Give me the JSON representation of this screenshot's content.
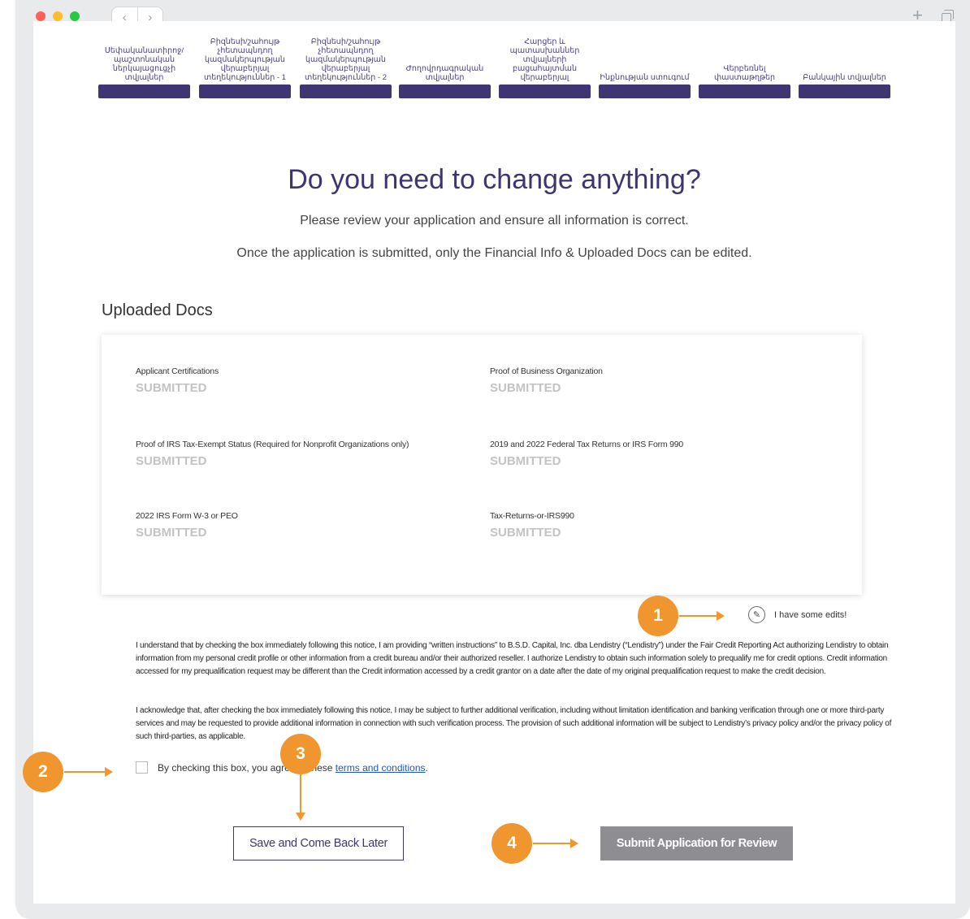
{
  "steps": [
    "Սեփականատիրոջ/պաշտոնական ներկայացուցչի տվյալներ",
    "Բիզնեսի/շահույթ չհետապնդող կազմակերպության վերաբերյալ տեղեկություններ - 1",
    "Բիզնեսի/շահույթ չհետապնդող կազմակերպության վերաբերյալ տեղեկություններ - 2",
    "Ժողովրդագրական տվյալներ",
    "Հարցեր և պատասխաններ տվյալների բացահայտման վերաբերյալ",
    "Ինքնության ստուգում",
    "Վերբեռնել փաստաթղթեր",
    "Բանկային տվյալներ"
  ],
  "review": {
    "heading": "Do you need to change anything?",
    "line1": "Please review your application and ensure all information is correct.",
    "line2": "Once the application is submitted, only the Financial Info & Uploaded Docs can be edited."
  },
  "uploaded": {
    "title": "Uploaded Docs",
    "docs": [
      {
        "name": "Applicant Certifications",
        "status": "SUBMITTED"
      },
      {
        "name": "Proof of Business Organization",
        "status": "SUBMITTED"
      },
      {
        "name": "Proof of IRS Tax-Exempt Status (Required for Nonprofit Organizations only)",
        "status": "SUBMITTED"
      },
      {
        "name": "2019 and 2022 Federal Tax Returns or IRS Form 990",
        "status": "SUBMITTED"
      },
      {
        "name": "2022 IRS Form W-3 or PEO",
        "status": "SUBMITTED"
      },
      {
        "name": "Tax-Returns-or-IRS990",
        "status": "SUBMITTED"
      }
    ]
  },
  "edits_label": "I have some edits!",
  "legal": {
    "p1": "I understand that by checking the box immediately following this notice, I am providing “written instructions” to B.S.D. Capital, Inc. dba Lendistry (“Lendistry”) under the Fair Credit Reporting Act authorizing Lendistry to obtain information from my personal credit profile or other information from a credit bureau and/or their authorized reseller. I authorize Lendistry to obtain such information solely to prequalify me for credit options. Credit information accessed for my prequalification request may be different than the Credit information accessed by a credit grantor on a date after the date of my original prequalification request to make the credit decision.",
    "p2": "I acknowledge that, after checking the box immediately following this notice, I may be subject to further additional verification, including without limitation identification and banking verification through one or more third-party services and may be requested to provide additional information in connection with such verification process. The provision of such additional information will be subject to Lendistry’s privacy policy and/or the privacy policy of such third-parties, as applicable."
  },
  "agree": {
    "text": "By checking this box, you agree to these ",
    "link": "terms and conditions",
    "end": "."
  },
  "buttons": {
    "save": "Save and Come Back Later",
    "submit": "Submit Application for Review"
  },
  "annotations": [
    "1",
    "2",
    "3",
    "4"
  ],
  "colors": {
    "accent": "#3f3573",
    "annotation": "#f0962e",
    "submitted": "#c3c3c3",
    "link": "#1a56c4"
  }
}
